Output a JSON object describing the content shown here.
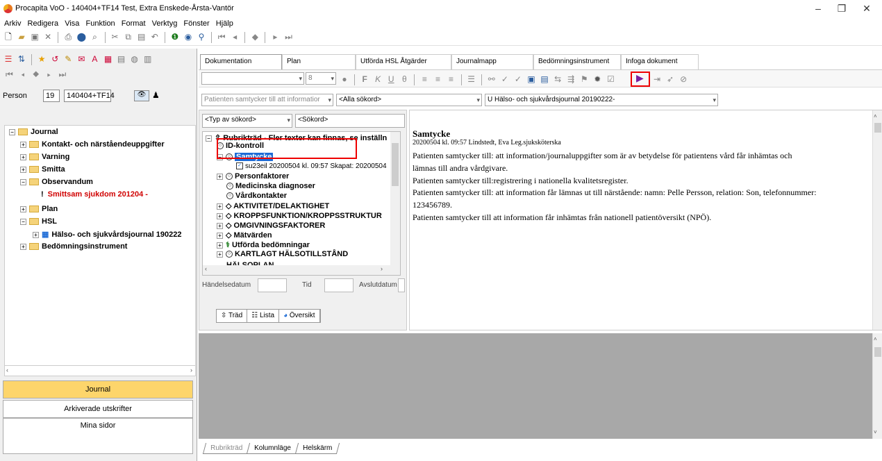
{
  "window": {
    "title": "Procapita VoO - 140404+TF14 Test, Extra Enskede-Årsta-Vantör",
    "controls": [
      "–",
      "❐",
      "✕"
    ]
  },
  "menu": [
    "Arkiv",
    "Redigera",
    "Visa",
    "Funktion",
    "Format",
    "Verktyg",
    "Fönster",
    "Hjälp"
  ],
  "person": {
    "label": "Person",
    "number": "19",
    "id": "140404+TF14"
  },
  "left_tree": {
    "root": "Journal",
    "items": [
      {
        "label": "Kontakt- och närståendeuppgifter"
      },
      {
        "label": "Varning"
      },
      {
        "label": "Smitta"
      },
      {
        "label": "Observandum"
      },
      {
        "label": "Smittsam sjukdom 201204 -"
      },
      {
        "label": "Plan"
      },
      {
        "label": "HSL"
      },
      {
        "label": "Hälso- och sjukvårdsjournal 190222"
      },
      {
        "label": "Bedömningsinstrument"
      }
    ]
  },
  "nav_buttons": [
    "Journal",
    "Arkiverade utskrifter",
    "Mina sidor"
  ],
  "tabs": [
    "Dokumentation",
    "Plan",
    "Utförda HSL Åtgärder",
    "Journalmapp",
    "Bedömningsinstrument",
    "Infoga dokument"
  ],
  "format_bar": {
    "font_size": "8"
  },
  "filters": {
    "template": "Patienten samtycker till att informatior",
    "search_word": "<Alla sökord>",
    "journal": "U Hälso- och sjukvårdsjournal 20190222-"
  },
  "search": {
    "type_placeholder": "<Typ av sökord>",
    "word_placeholder": "<Sökord>"
  },
  "mid_tree": {
    "header": "Rubrikträd - Fler texter kan finnas, se inställn",
    "items": [
      "ID-kontroll",
      "Samtycke",
      "su23eil 20200504  kl. 09:57  Skapat: 20200504",
      "Personfaktorer",
      "Medicinska diagnoser",
      "Vårdkontakter",
      "AKTIVITET/DELAKTIGHET",
      "KROPPSFUNKTION/KROPPSSTRUKTUR",
      "OMGIVNINGSFAKTORER",
      "Mätvärden",
      "Utförda bedömningar",
      "KARTLAGT HÄLSOTILLSTÅND",
      "HÄLSOPLAN"
    ]
  },
  "date_fields": {
    "event_date": "Händelsedatum",
    "time": "Tid",
    "end_date": "Avslutdatum"
  },
  "view_tabs": [
    "Träd",
    "Lista",
    "Översikt"
  ],
  "document": {
    "title": "Samtycke",
    "meta": "20200504 kl. 09:57  Lindstedt, Eva  Leg.sjuksköterska",
    "lines": [
      "Patienten samtycker till: att information/journaluppgifter som är av betydelse för patientens vård får inhämtas och",
      "lämnas till andra vårdgivare.",
      "Patienten samtycker till:registrering i nationella kvalitetsregister.",
      "Patienten samtycker till: att information får lämnas ut till närstående: namn: Pelle Persson, relation: Son, telefonnummer:",
      "123456789.",
      "Patienten samtycker till att information får inhämtas från nationell patientöversikt (NPÖ)."
    ]
  },
  "bottom_tabs": [
    "Rubrikträd",
    "Kolumnläge",
    "Helskärm"
  ],
  "colors": {
    "selection": "#1e6cd6",
    "highlight_box": "#e00000",
    "warning_text": "#d00000",
    "nav_active": "#fdd56b"
  }
}
